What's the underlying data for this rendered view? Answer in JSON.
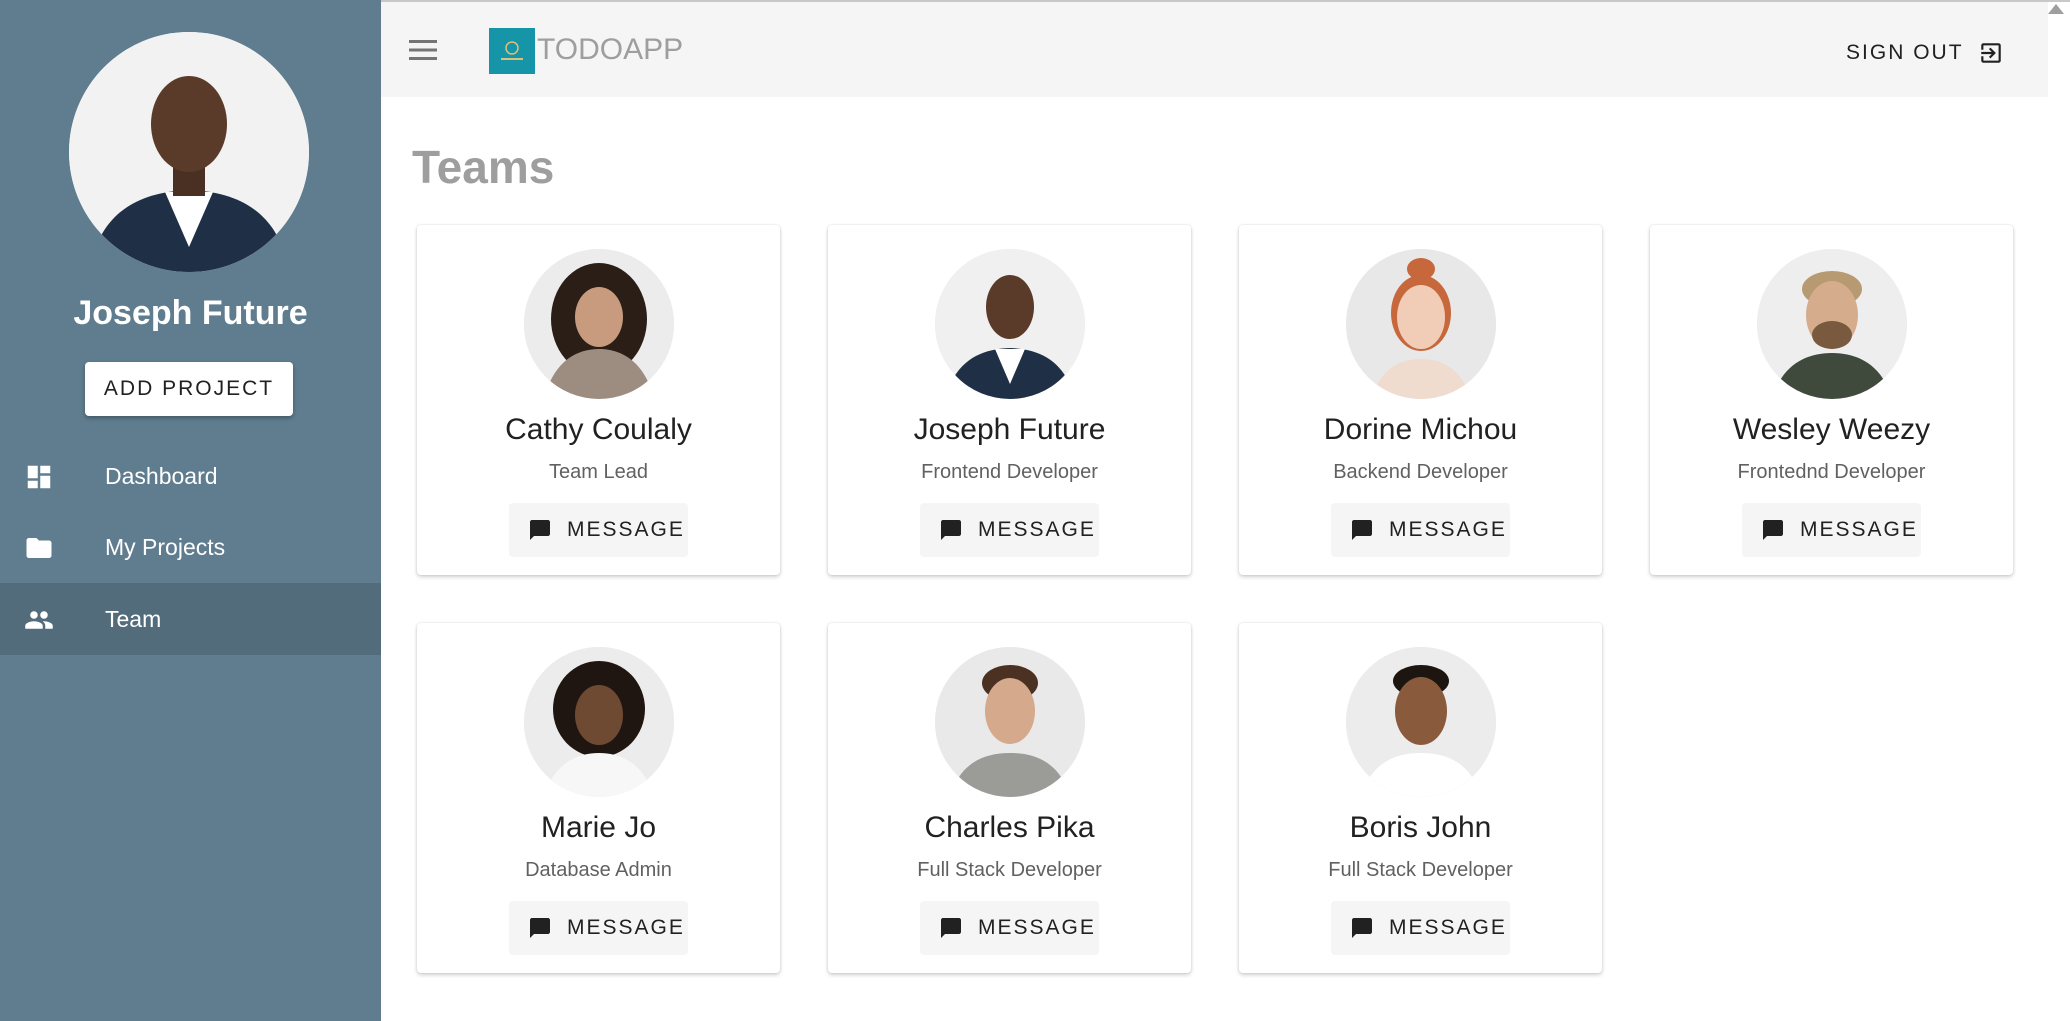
{
  "app": {
    "logo_text": "TODOAPP",
    "sign_out_label": "SIGN OUT"
  },
  "sidebar": {
    "user_name": "Joseph Future",
    "add_project_label": "ADD PROJECT",
    "items": [
      {
        "label": "Dashboard",
        "icon": "dashboard-icon",
        "active": false
      },
      {
        "label": "My Projects",
        "icon": "folder-icon",
        "active": false
      },
      {
        "label": "Team",
        "icon": "people-icon",
        "active": true
      }
    ]
  },
  "page": {
    "title": "Teams"
  },
  "team": [
    {
      "name": "Cathy Coulaly",
      "role": "Team Lead",
      "button": "MESSAGE"
    },
    {
      "name": "Joseph Future",
      "role": "Frontend Developer",
      "button": "MESSAGE"
    },
    {
      "name": "Dorine Michou",
      "role": "Backend Developer",
      "button": "MESSAGE"
    },
    {
      "name": "Wesley Weezy",
      "role": "Frontednd Developer",
      "button": "MESSAGE"
    },
    {
      "name": "Marie Jo",
      "role": "Database Admin",
      "button": "MESSAGE"
    },
    {
      "name": "Charles Pika",
      "role": "Full Stack Developer",
      "button": "MESSAGE"
    },
    {
      "name": "Boris John",
      "role": "Full Stack Developer",
      "button": "MESSAGE"
    }
  ],
  "colors": {
    "sidebar_bg": "#5f7d8e",
    "sidebar_active": "#526c7b",
    "topbar_bg": "#f5f5f5",
    "logo_bg": "#1795a8",
    "title_color": "#9e9e9e"
  }
}
